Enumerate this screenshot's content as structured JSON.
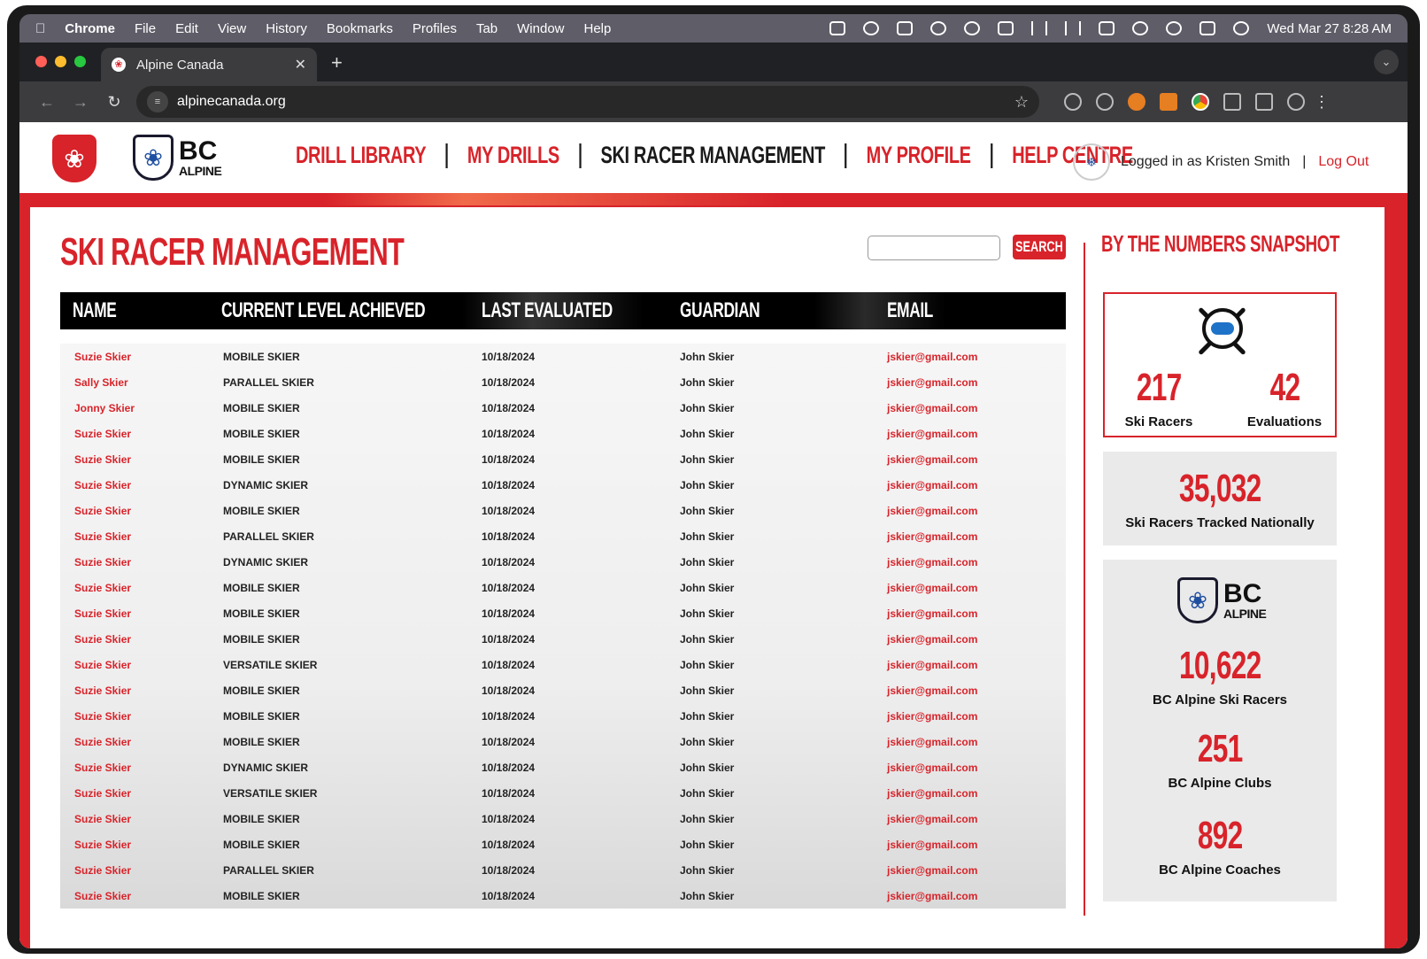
{
  "menubar": {
    "app": "Chrome",
    "items": [
      "File",
      "Edit",
      "View",
      "History",
      "Bookmarks",
      "Profiles",
      "Tab",
      "Window",
      "Help"
    ],
    "datetime": "Wed Mar 27  8:28 AM"
  },
  "browser": {
    "tab_title": "Alpine Canada",
    "url": "alpinecanada.org"
  },
  "site": {
    "logo_text_1": "BC",
    "logo_text_2": "ALPINE",
    "nav": [
      "DRILL LIBRARY",
      "MY DRILLS",
      "SKI RACER MANAGEMENT",
      "MY PROFILE",
      "HELP CENTRE"
    ],
    "active_nav": "SKI RACER MANAGEMENT",
    "logged_in": "Logged in as Kristen Smith",
    "logout": "Log Out",
    "colors": {
      "accent": "#d8232a",
      "dark": "#1a1a1a",
      "bc_blue": "#1e4fa0"
    }
  },
  "page": {
    "title": "SKI RACER MANAGEMENT",
    "search_placeholder": "",
    "search_button": "SEARCH"
  },
  "table": {
    "headers": [
      "NAME",
      "CURRENT LEVEL ACHIEVED",
      "LAST EVALUATED",
      "GUARDIAN",
      "EMAIL"
    ],
    "rows": [
      [
        "Suzie Skier",
        "MOBILE SKIER",
        "10/18/2024",
        "John Skier",
        "jskier@gmail.com"
      ],
      [
        "Sally Skier",
        "PARALLEL SKIER",
        "10/18/2024",
        "John Skier",
        "jskier@gmail.com"
      ],
      [
        "Jonny Skier",
        "MOBILE SKIER",
        "10/18/2024",
        "John Skier",
        "jskier@gmail.com"
      ],
      [
        "Suzie Skier",
        "MOBILE SKIER",
        "10/18/2024",
        "John Skier",
        "jskier@gmail.com"
      ],
      [
        "Suzie Skier",
        "MOBILE SKIER",
        "10/18/2024",
        "John Skier",
        "jskier@gmail.com"
      ],
      [
        "Suzie Skier",
        "DYNAMIC SKIER",
        "10/18/2024",
        "John Skier",
        "jskier@gmail.com"
      ],
      [
        "Suzie Skier",
        "MOBILE SKIER",
        "10/18/2024",
        "John Skier",
        "jskier@gmail.com"
      ],
      [
        "Suzie Skier",
        "PARALLEL SKIER",
        "10/18/2024",
        "John Skier",
        "jskier@gmail.com"
      ],
      [
        "Suzie Skier",
        "DYNAMIC SKIER",
        "10/18/2024",
        "John Skier",
        "jskier@gmail.com"
      ],
      [
        "Suzie Skier",
        "MOBILE SKIER",
        "10/18/2024",
        "John Skier",
        "jskier@gmail.com"
      ],
      [
        "Suzie Skier",
        "MOBILE SKIER",
        "10/18/2024",
        "John Skier",
        "jskier@gmail.com"
      ],
      [
        "Suzie Skier",
        "MOBILE SKIER",
        "10/18/2024",
        "John Skier",
        "jskier@gmail.com"
      ],
      [
        "Suzie Skier",
        "VERSATILE SKIER",
        "10/18/2024",
        "John Skier",
        "jskier@gmail.com"
      ],
      [
        "Suzie Skier",
        "MOBILE SKIER",
        "10/18/2024",
        "John Skier",
        "jskier@gmail.com"
      ],
      [
        "Suzie Skier",
        "MOBILE SKIER",
        "10/18/2024",
        "John Skier",
        "jskier@gmail.com"
      ],
      [
        "Suzie Skier",
        "MOBILE SKIER",
        "10/18/2024",
        "John Skier",
        "jskier@gmail.com"
      ],
      [
        "Suzie Skier",
        "DYNAMIC SKIER",
        "10/18/2024",
        "John Skier",
        "jskier@gmail.com"
      ],
      [
        "Suzie Skier",
        "VERSATILE SKIER",
        "10/18/2024",
        "John Skier",
        "jskier@gmail.com"
      ],
      [
        "Suzie Skier",
        "MOBILE SKIER",
        "10/18/2024",
        "John Skier",
        "jskier@gmail.com"
      ],
      [
        "Suzie Skier",
        "MOBILE SKIER",
        "10/18/2024",
        "John Skier",
        "jskier@gmail.com"
      ],
      [
        "Suzie Skier",
        "PARALLEL SKIER",
        "10/18/2024",
        "John Skier",
        "jskier@gmail.com"
      ],
      [
        "Suzie Skier",
        "MOBILE SKIER",
        "10/18/2024",
        "John Skier",
        "jskier@gmail.com"
      ]
    ]
  },
  "sidebar": {
    "title": "BY THE NUMBERS SNAPSHOT",
    "ski_racers": "217",
    "ski_racers_label": "Ski Racers",
    "evaluations": "42",
    "evaluations_label": "Evaluations",
    "national": "35,032",
    "national_label": "Ski Racers Tracked Nationally",
    "bc_racers": "10,622",
    "bc_racers_label": "BC Alpine Ski Racers",
    "bc_clubs": "251",
    "bc_clubs_label": "BC Alpine Clubs",
    "bc_coaches": "892",
    "bc_coaches_label": "BC Alpine Coaches"
  }
}
